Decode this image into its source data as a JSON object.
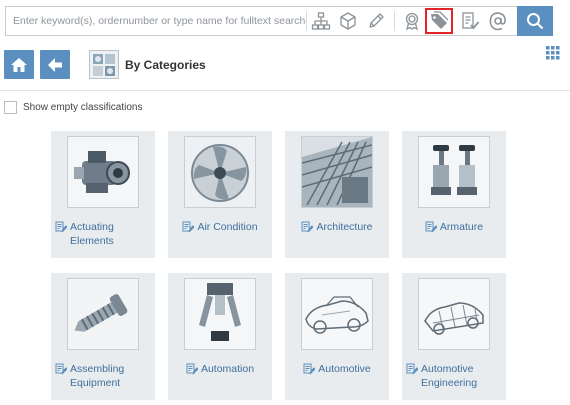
{
  "search": {
    "placeholder": "Enter keyword(s), ordernumber or type name for fulltext search"
  },
  "toolbar": {
    "icons": [
      "hierarchy-icon",
      "cube-icon",
      "pencil-icon",
      "certificate-icon",
      "tag-icon",
      "checklist-icon",
      "at-icon",
      "search-icon"
    ],
    "highlighted": "tag-icon"
  },
  "header": {
    "title": "By Categories"
  },
  "options": {
    "show_empty_label": "Show empty classifications",
    "show_empty_checked": false
  },
  "categories": [
    {
      "label": "Actuating Elements"
    },
    {
      "label": "Air Condition"
    },
    {
      "label": "Architecture"
    },
    {
      "label": "Armature"
    },
    {
      "label": "Assembling Equipment"
    },
    {
      "label": "Automation"
    },
    {
      "label": "Automotive"
    },
    {
      "label": "Automotive Engineering"
    }
  ],
  "colors": {
    "accent": "#5b8fbf",
    "link": "#3f6f9c",
    "tile_bg": "#e8ecef",
    "highlight": "#e0242a"
  }
}
